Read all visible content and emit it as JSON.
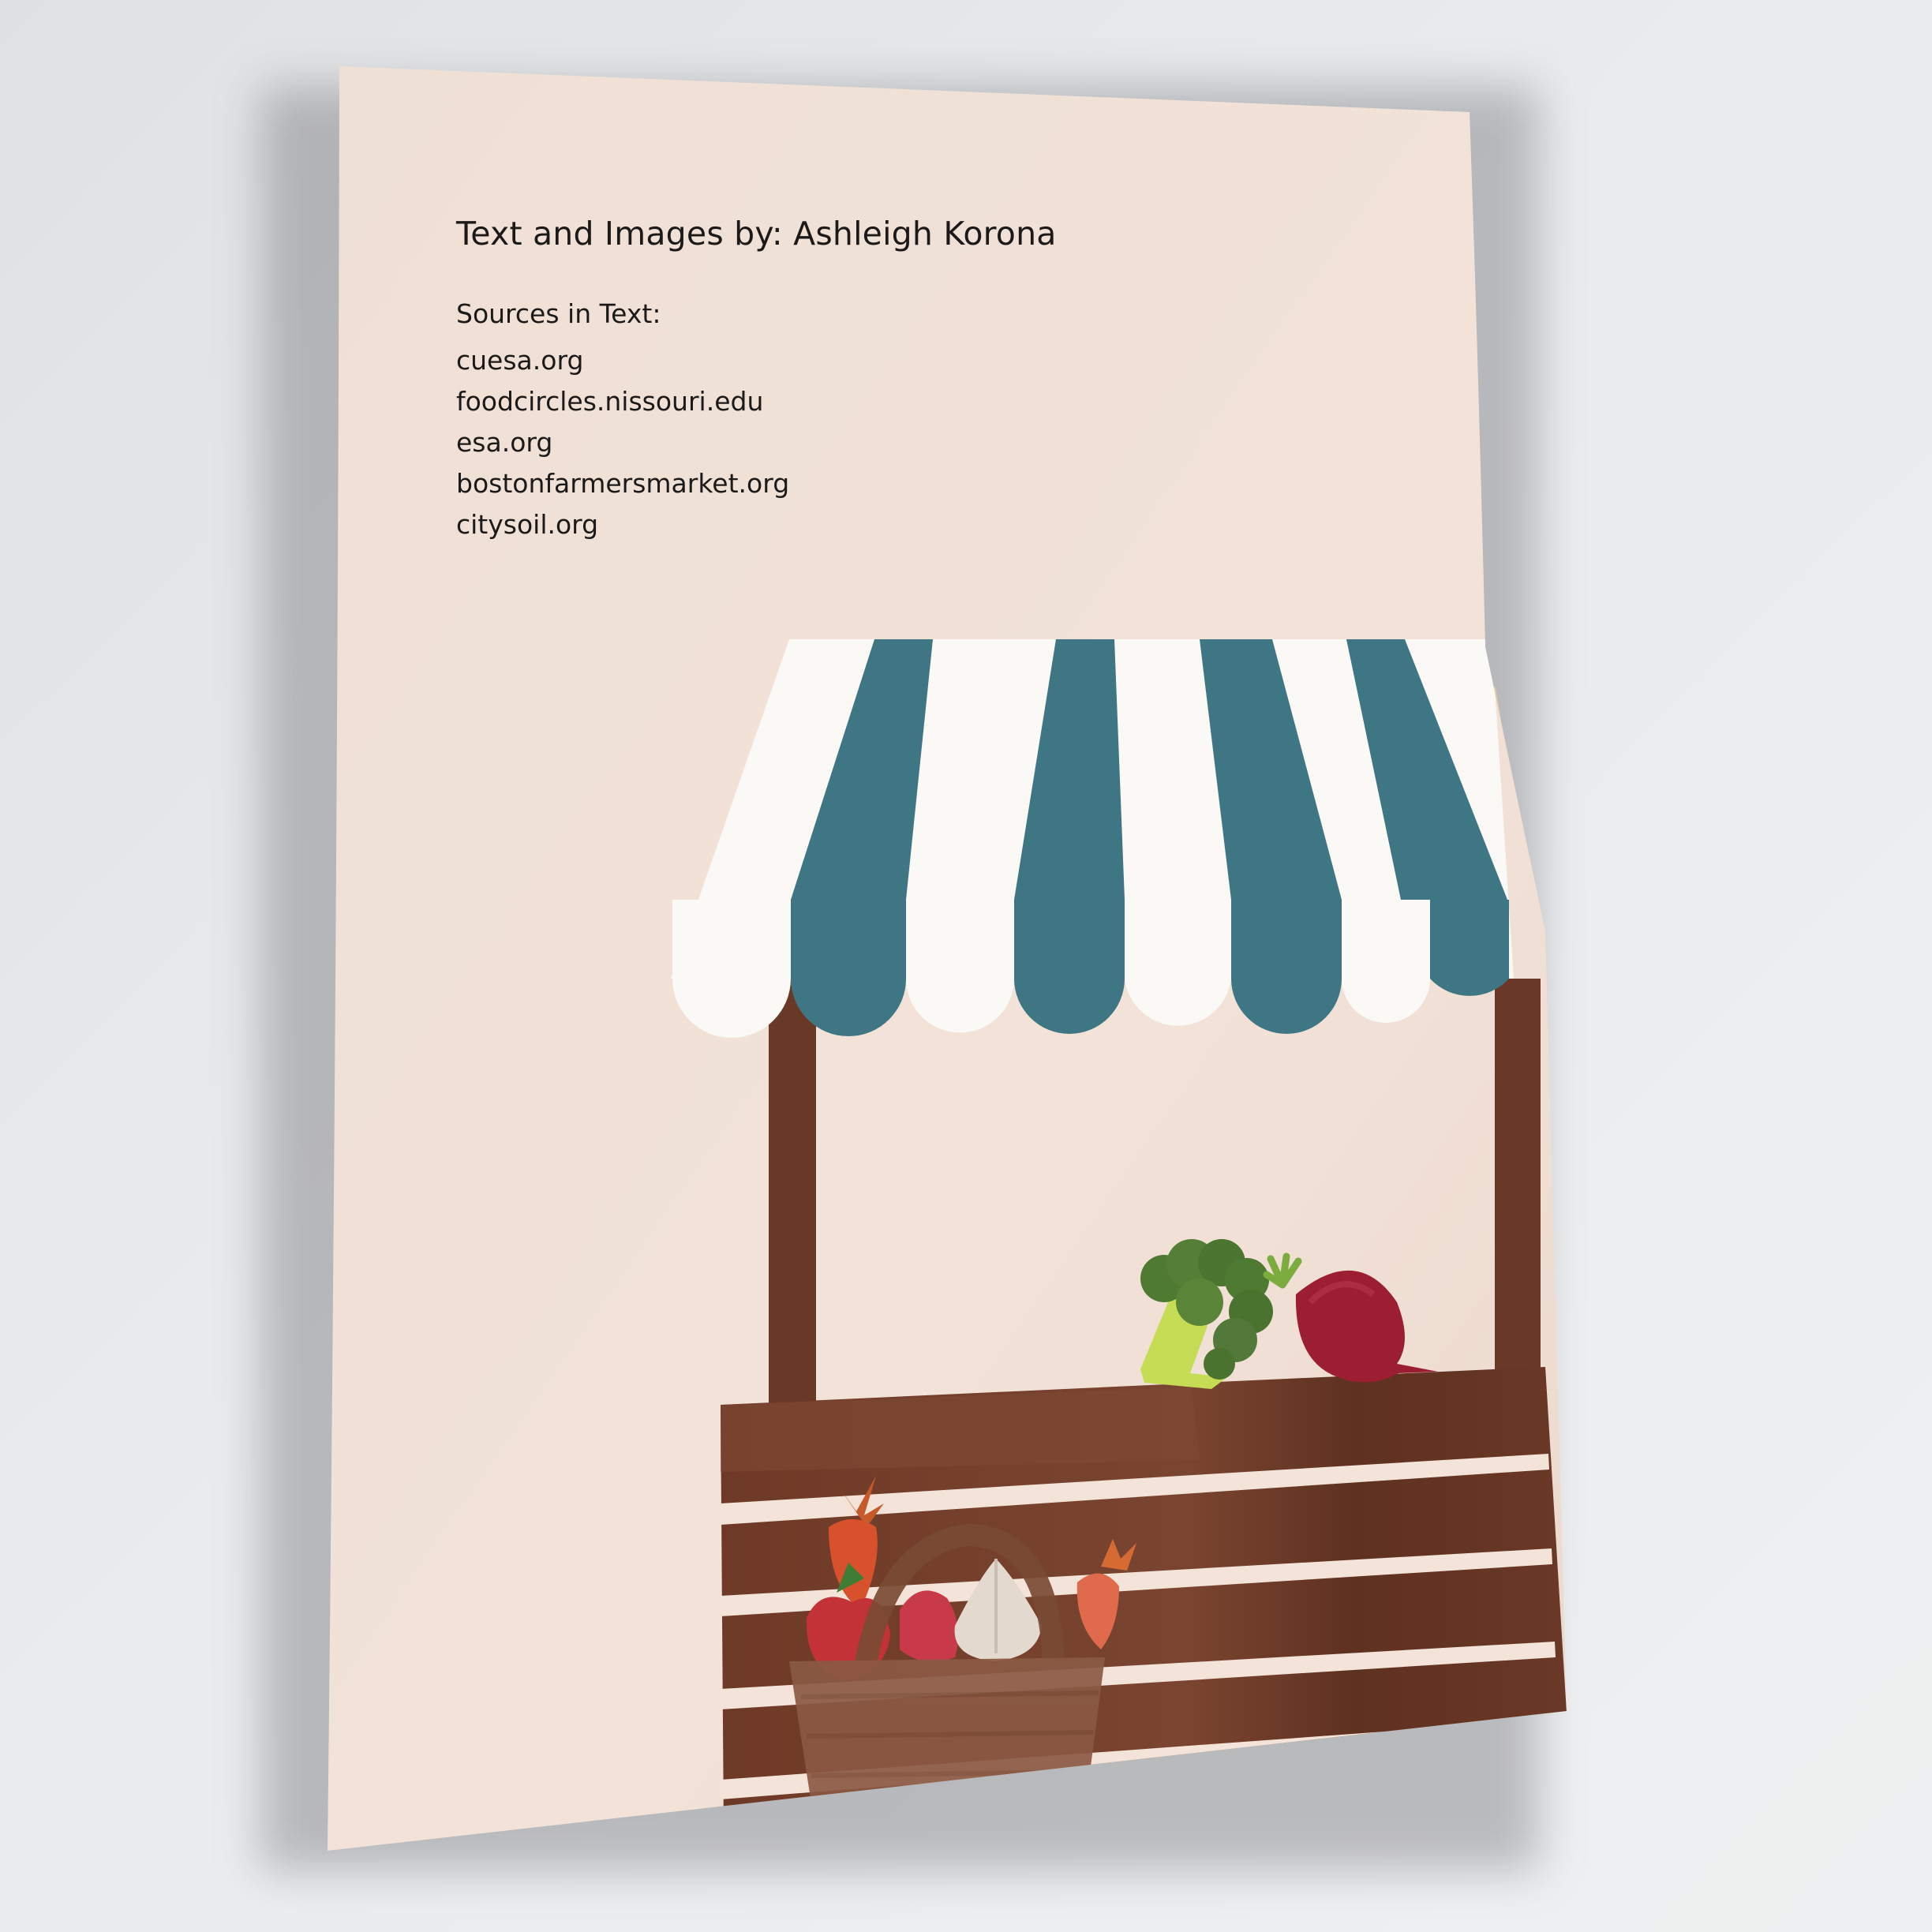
{
  "page": {
    "credit_label": "Text and Images by:",
    "author": "Ashleigh Korona",
    "sources_heading": "Sources in Text:",
    "sources": [
      "cuesa.org",
      "foodcircles.nissouri.edu",
      "esa.org",
      "bostonfarmersmarket.org",
      "citysoil.org"
    ]
  },
  "colors": {
    "paper": "#f0dfd3",
    "awning_teal": "#3f7683",
    "awning_white": "#fbf9f6",
    "wood": "#6a3826",
    "broccoli": "#4f7a32",
    "beet": "#9c1e33",
    "carrot": "#d8512d"
  },
  "illustration": {
    "awning_icon": "striped-awning",
    "produce_icons": [
      "broccoli-icon",
      "beet-icon",
      "carrot-icon",
      "apple-icon",
      "garlic-icon",
      "basket-icon"
    ]
  }
}
